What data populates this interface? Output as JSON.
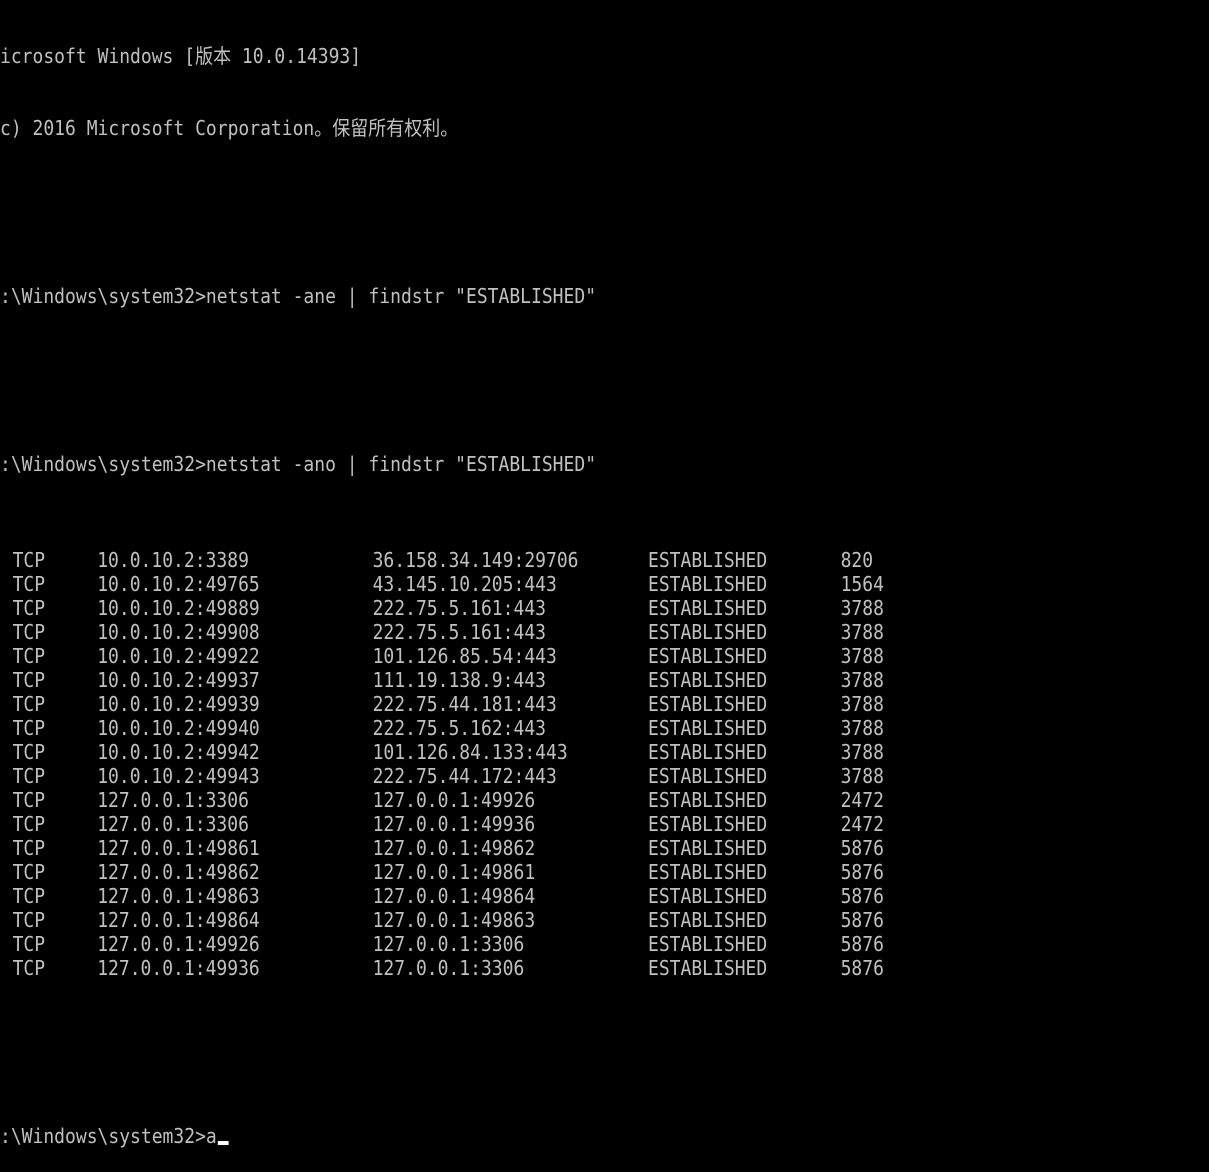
{
  "window": {
    "background": "#000000",
    "text_color": "#c0c0c0"
  },
  "header": {
    "version_line": "icrosoft Windows [版本 10.0.14393]",
    "copyright_line": "c) 2016 Microsoft Corporation。保留所有权利。"
  },
  "commands": [
    {
      "prompt": ":\\Windows\\system32>",
      "command": "netstat -ane | findstr \"ESTABLISHED\""
    },
    {
      "prompt": ":\\Windows\\system32>",
      "command": "netstat -ano | findstr \"ESTABLISHED\""
    }
  ],
  "connections": [
    {
      "proto": "TCP",
      "local": "10.0.10.2:3389",
      "remote": "36.158.34.149:29706",
      "state": "ESTABLISHED",
      "pid": "820"
    },
    {
      "proto": "TCP",
      "local": "10.0.10.2:49765",
      "remote": "43.145.10.205:443",
      "state": "ESTABLISHED",
      "pid": "1564"
    },
    {
      "proto": "TCP",
      "local": "10.0.10.2:49889",
      "remote": "222.75.5.161:443",
      "state": "ESTABLISHED",
      "pid": "3788"
    },
    {
      "proto": "TCP",
      "local": "10.0.10.2:49908",
      "remote": "222.75.5.161:443",
      "state": "ESTABLISHED",
      "pid": "3788"
    },
    {
      "proto": "TCP",
      "local": "10.0.10.2:49922",
      "remote": "101.126.85.54:443",
      "state": "ESTABLISHED",
      "pid": "3788"
    },
    {
      "proto": "TCP",
      "local": "10.0.10.2:49937",
      "remote": "111.19.138.9:443",
      "state": "ESTABLISHED",
      "pid": "3788"
    },
    {
      "proto": "TCP",
      "local": "10.0.10.2:49939",
      "remote": "222.75.44.181:443",
      "state": "ESTABLISHED",
      "pid": "3788"
    },
    {
      "proto": "TCP",
      "local": "10.0.10.2:49940",
      "remote": "222.75.5.162:443",
      "state": "ESTABLISHED",
      "pid": "3788"
    },
    {
      "proto": "TCP",
      "local": "10.0.10.2:49942",
      "remote": "101.126.84.133:443",
      "state": "ESTABLISHED",
      "pid": "3788"
    },
    {
      "proto": "TCP",
      "local": "10.0.10.2:49943",
      "remote": "222.75.44.172:443",
      "state": "ESTABLISHED",
      "pid": "3788"
    },
    {
      "proto": "TCP",
      "local": "127.0.0.1:3306",
      "remote": "127.0.0.1:49926",
      "state": "ESTABLISHED",
      "pid": "2472"
    },
    {
      "proto": "TCP",
      "local": "127.0.0.1:3306",
      "remote": "127.0.0.1:49936",
      "state": "ESTABLISHED",
      "pid": "2472"
    },
    {
      "proto": "TCP",
      "local": "127.0.0.1:49861",
      "remote": "127.0.0.1:49862",
      "state": "ESTABLISHED",
      "pid": "5876"
    },
    {
      "proto": "TCP",
      "local": "127.0.0.1:49862",
      "remote": "127.0.0.1:49861",
      "state": "ESTABLISHED",
      "pid": "5876"
    },
    {
      "proto": "TCP",
      "local": "127.0.0.1:49863",
      "remote": "127.0.0.1:49864",
      "state": "ESTABLISHED",
      "pid": "5876"
    },
    {
      "proto": "TCP",
      "local": "127.0.0.1:49864",
      "remote": "127.0.0.1:49863",
      "state": "ESTABLISHED",
      "pid": "5876"
    },
    {
      "proto": "TCP",
      "local": "127.0.0.1:49926",
      "remote": "127.0.0.1:3306",
      "state": "ESTABLISHED",
      "pid": "5876"
    },
    {
      "proto": "TCP",
      "local": "127.0.0.1:49936",
      "remote": "127.0.0.1:3306",
      "state": "ESTABLISHED",
      "pid": "5876"
    }
  ],
  "current_prompt": {
    "prompt": ":\\Windows\\system32>",
    "input": "a"
  }
}
